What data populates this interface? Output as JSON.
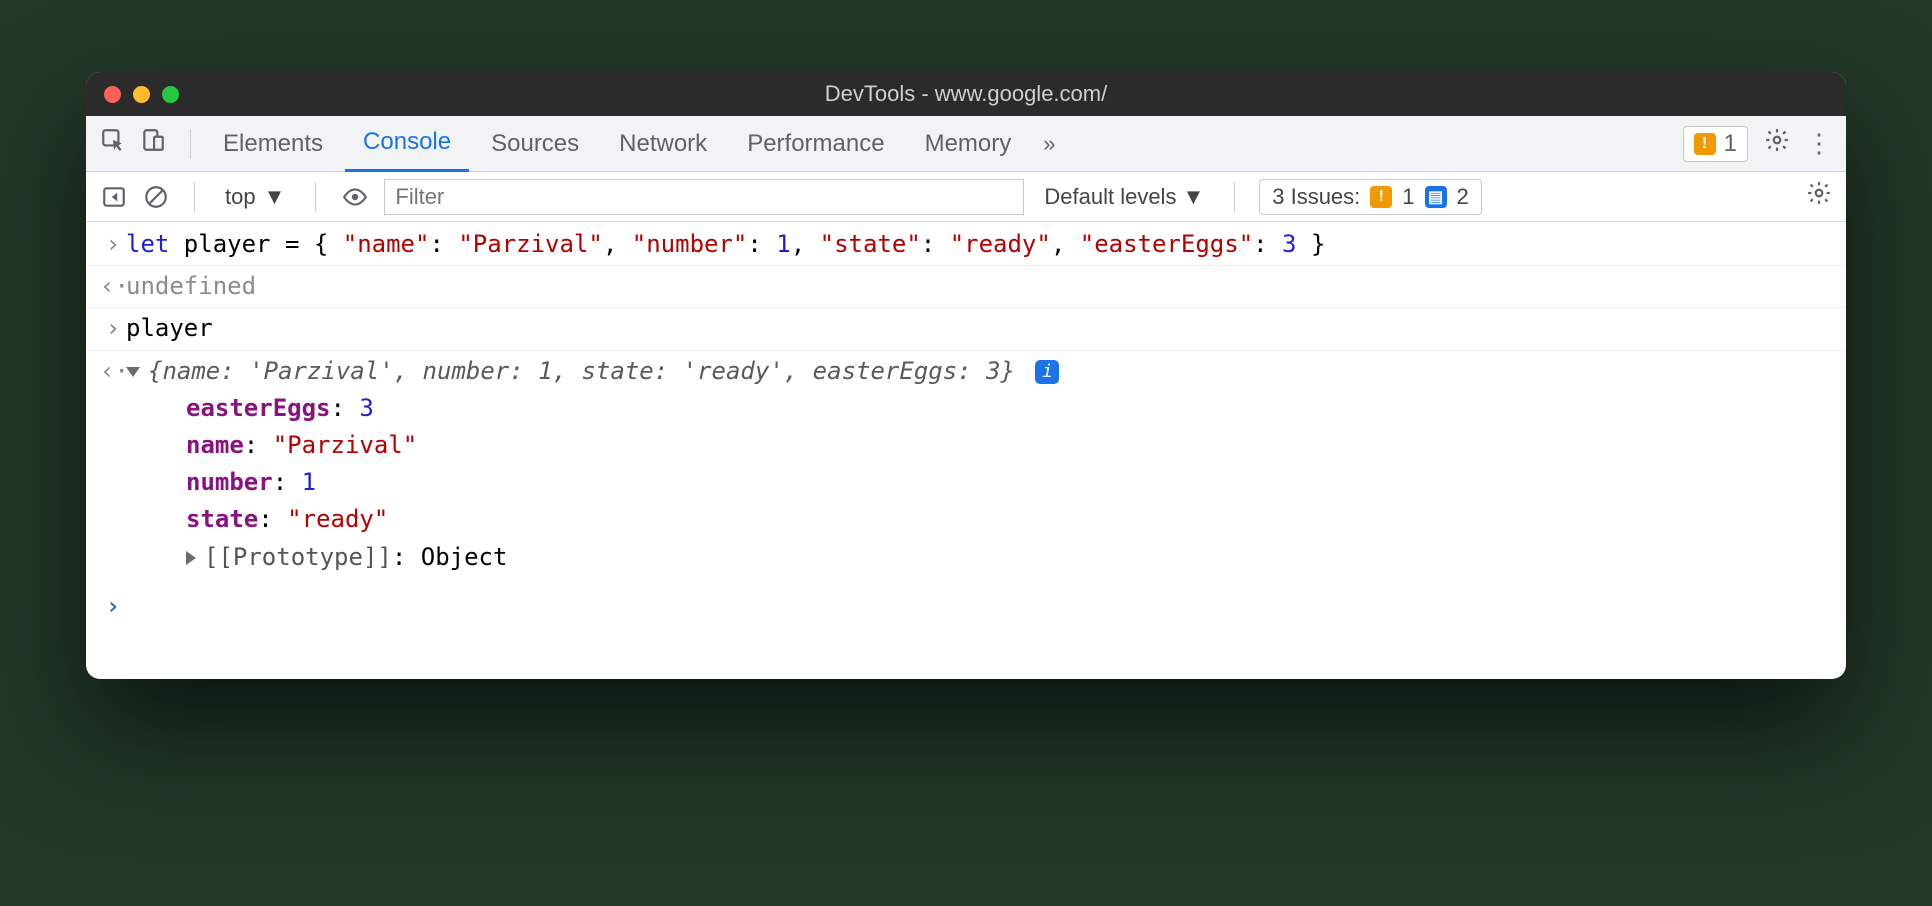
{
  "window": {
    "title": "DevTools - www.google.com/"
  },
  "tabs": [
    "Elements",
    "Console",
    "Sources",
    "Network",
    "Performance",
    "Memory"
  ],
  "tabs_active_index": 1,
  "tabbar": {
    "warn_count": "1"
  },
  "toolbar": {
    "context": "top",
    "filter_placeholder": "Filter",
    "levels": "Default levels",
    "issues_label": "3 Issues:",
    "issues_warn": "1",
    "issues_info": "2"
  },
  "console_lines": {
    "input1_kw": "let",
    "input1_rest": " player = { ",
    "k_name": "\"name\"",
    "v_name": "\"Parzival\"",
    "k_number": "\"number\"",
    "v_number": "1",
    "k_state": "\"state\"",
    "v_state": "\"ready\"",
    "k_eggs": "\"easterEggs\"",
    "v_eggs": "3",
    "input1_close": " }",
    "out1": "undefined",
    "input2": "player",
    "summary_open": "{",
    "summary": "name: 'Parzival', number: 1, state: 'ready', easterEggs: 3",
    "summary_close": "}",
    "prop_eggs_k": "easterEggs",
    "prop_eggs_v": "3",
    "prop_name_k": "name",
    "prop_name_v": "\"Parzival\"",
    "prop_number_k": "number",
    "prop_number_v": "1",
    "prop_state_k": "state",
    "prop_state_v": "\"ready\"",
    "proto_label": "[[Prototype]]",
    "proto_val": "Object"
  }
}
